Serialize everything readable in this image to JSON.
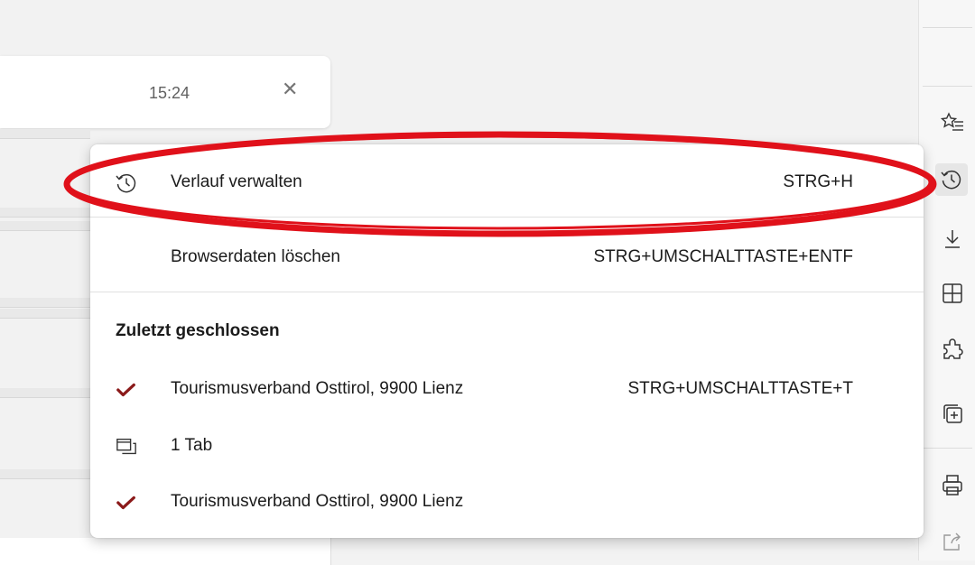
{
  "background": {
    "time": "15:24"
  },
  "menu": {
    "manage_history": {
      "label": "Verlauf verwalten",
      "shortcut": "STRG+H"
    },
    "clear_data": {
      "label": "Browserdaten löschen",
      "shortcut": "STRG+UMSCHALTTASTE+ENTF"
    },
    "recently_closed_title": "Zuletzt geschlossen",
    "items": [
      {
        "label": "Tourismusverband Osttirol, 9900 Lienz",
        "shortcut": "STRG+UMSCHALTTASTE+T",
        "icon": "checkmark-icon"
      },
      {
        "label": "1 Tab",
        "shortcut": "",
        "icon": "window-tabs-icon"
      },
      {
        "label": "Tourismusverband Osttirol, 9900 Lienz",
        "shortcut": "",
        "icon": "checkmark-icon"
      }
    ]
  },
  "colors": {
    "annotation": "#e0111a",
    "checkmark": "#8b1a1a",
    "menu_bg": "#ffffff"
  },
  "toolbar_icons": [
    "favorites-icon",
    "history-icon",
    "downloads-icon",
    "collections-icon",
    "extensions-icon",
    "add-tab-icon",
    "print-icon",
    "share-icon"
  ]
}
